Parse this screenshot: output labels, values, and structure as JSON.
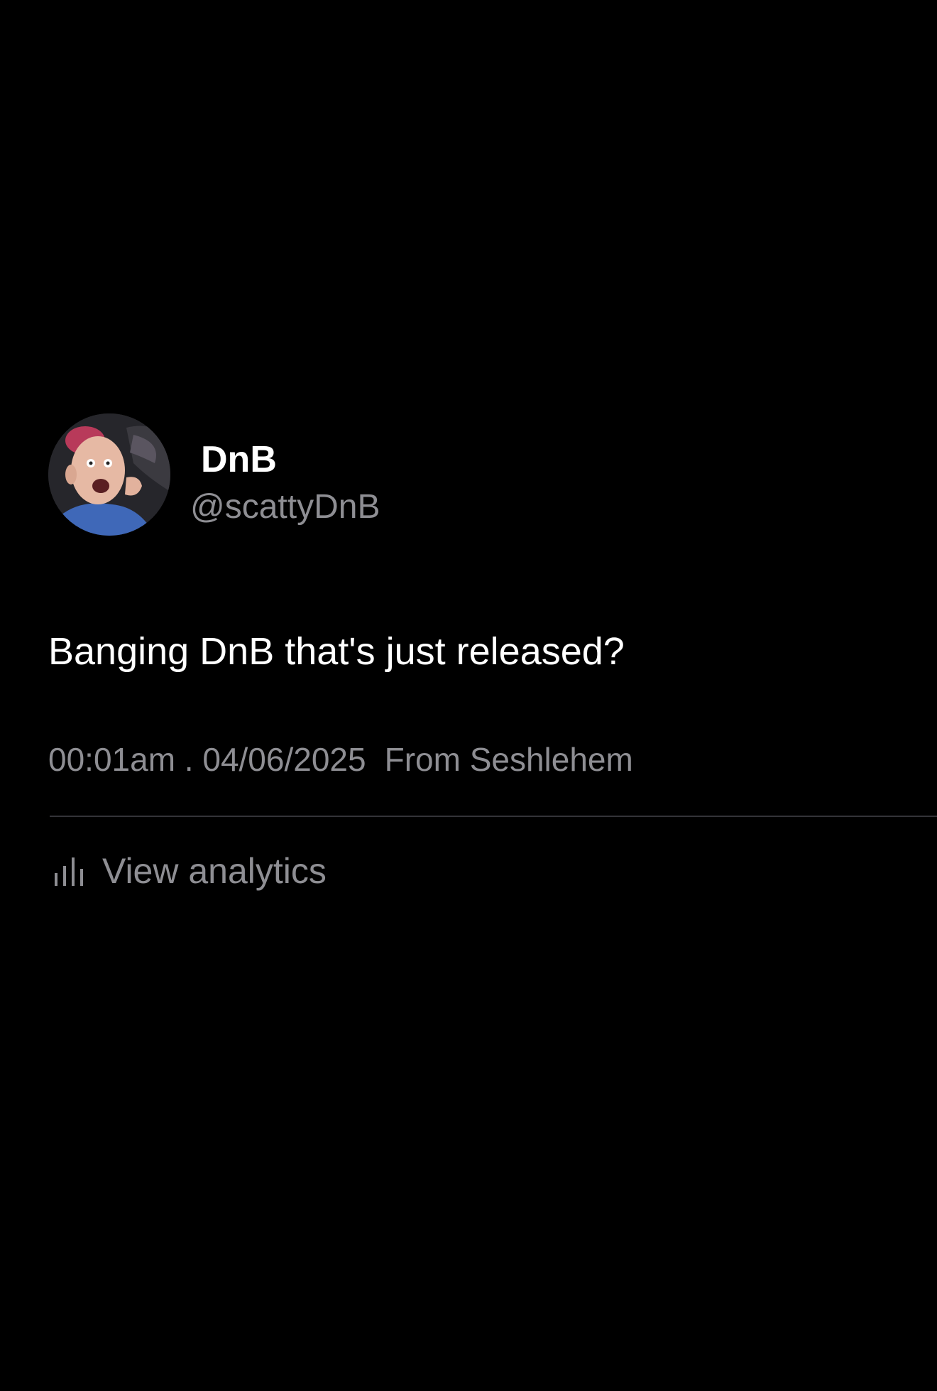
{
  "post": {
    "author": {
      "display_name": "DnB",
      "handle": "@scattyDnB",
      "avatar_icon": "avatar-photo"
    },
    "text": "Banging DnB that's just released?",
    "meta": {
      "time_date": "00:01am . 04/06/2025",
      "source": "From Seshlehem"
    },
    "analytics": {
      "label": "View analytics",
      "icon": "bar-chart-icon"
    }
  },
  "colors": {
    "background": "#000000",
    "primary_text": "#ffffff",
    "secondary_text": "#8e8e93",
    "divider": "#333338"
  }
}
